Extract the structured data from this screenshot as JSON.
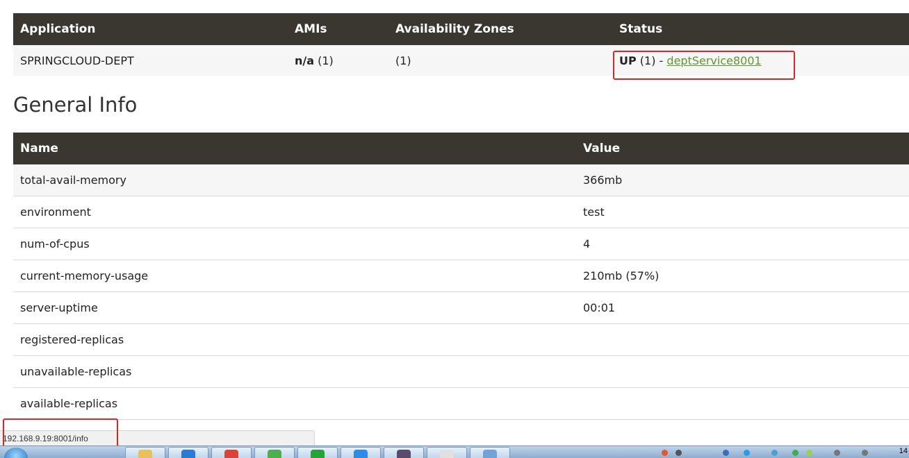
{
  "apps_table": {
    "headers": [
      "Application",
      "AMIs",
      "Availability Zones",
      "Status"
    ],
    "row": {
      "application": "SPRINGCLOUD-DEPT",
      "amis_bold": "n/a",
      "amis_count": "(1)",
      "zones": "(1)",
      "status_prefix_bold": "UP",
      "status_middle": " (1) - ",
      "status_link": "deptService8001"
    }
  },
  "general_info": {
    "title": "General Info",
    "headers": [
      "Name",
      "Value"
    ],
    "rows": [
      {
        "name": "total-avail-memory",
        "value": "366mb"
      },
      {
        "name": "environment",
        "value": "test"
      },
      {
        "name": "num-of-cpus",
        "value": "4"
      },
      {
        "name": "current-memory-usage",
        "value": "210mb (57%)"
      },
      {
        "name": "server-uptime",
        "value": "00:01"
      },
      {
        "name": "registered-replicas",
        "value": ""
      },
      {
        "name": "unavailable-replicas",
        "value": ""
      },
      {
        "name": "available-replicas",
        "value": ""
      }
    ]
  },
  "status_bar": {
    "url": "192.168.9.19:8001/info"
  },
  "taskbar": {
    "clock": "14"
  },
  "colors": {
    "header_bg": "#3a3630",
    "link": "#5a9b2b",
    "highlight": "#e02424"
  }
}
